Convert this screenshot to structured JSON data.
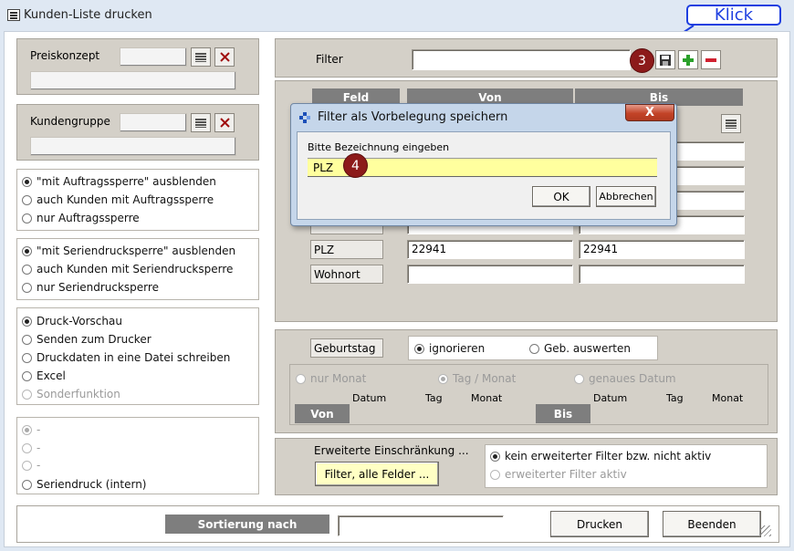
{
  "window": {
    "title": "Kunden-Liste drucken"
  },
  "callout": {
    "label": "Klick"
  },
  "badges": {
    "step3": "3",
    "step4": "4"
  },
  "preis": {
    "label": "Preiskonzept"
  },
  "kunden": {
    "label": "Kundengruppe"
  },
  "auftrag": {
    "options": [
      {
        "label": "\"mit Auftragssperre\" ausblenden",
        "checked": true
      },
      {
        "label": "auch Kunden mit Auftragssperre",
        "checked": false
      },
      {
        "label": "nur Auftragssperre",
        "checked": false
      }
    ]
  },
  "serien": {
    "options": [
      {
        "label": "\"mit Seriendrucksperre\" ausblenden",
        "checked": true
      },
      {
        "label": "auch Kunden mit Seriendrucksperre",
        "checked": false
      },
      {
        "label": "nur Seriendrucksperre",
        "checked": false
      }
    ]
  },
  "ausgabe": {
    "options": [
      {
        "label": "Druck-Vorschau",
        "checked": true
      },
      {
        "label": "Senden zum Drucker",
        "checked": false
      },
      {
        "label": "Druckdaten in eine Datei schreiben",
        "checked": false
      },
      {
        "label": "Excel",
        "checked": false
      },
      {
        "label": "Sonderfunktion",
        "checked": false,
        "disabled": true
      }
    ]
  },
  "extra": {
    "options": [
      {
        "label": "-",
        "checked": true,
        "disabled": true
      },
      {
        "label": "-",
        "checked": false,
        "disabled": true
      },
      {
        "label": "-",
        "checked": false,
        "disabled": true
      },
      {
        "label": "Seriendruck (intern)",
        "checked": false
      }
    ]
  },
  "filter": {
    "label": "Filter",
    "value": ""
  },
  "table": {
    "headers": {
      "feld": "Feld",
      "von": "Von",
      "bis": "Bis"
    },
    "rows": [
      {
        "feld": "PLZ",
        "von": "22941",
        "bis": "22941"
      },
      {
        "feld": "Wohnort",
        "von": "",
        "bis": ""
      }
    ]
  },
  "geburtstag": {
    "label": "Geburtstag",
    "opt_ignore": "ignorieren",
    "opt_eval": "Geb. auswerten",
    "opt_month": "nur Monat",
    "opt_daymonth": "Tag / Monat",
    "opt_exact": "genaues Datum",
    "col_datum": "Datum",
    "col_tag": "Tag",
    "col_monat": "Monat",
    "von": "Von",
    "bis": "Bis"
  },
  "erweitert": {
    "label": "Erweiterte Einschränkung ...",
    "button": "Filter, alle Felder ...",
    "opt_none": "kein erweiterter Filter bzw. nicht aktiv",
    "opt_active": "erweiterter Filter aktiv"
  },
  "bottom": {
    "sort_label": "Sortierung nach",
    "sort_value": "",
    "print": "Drucken",
    "quit": "Beenden"
  },
  "dialog": {
    "title": "Filter als Vorbelegung speichern",
    "prompt": "Bitte Bezeichnung eingeben",
    "value": "PLZ",
    "ok": "OK",
    "cancel": "Abbrechen",
    "close": "X"
  },
  "colors": {
    "accent_red": "#8c1a1a",
    "callout_blue": "#1e3fe0",
    "input_yellow": "#ffff9e"
  }
}
